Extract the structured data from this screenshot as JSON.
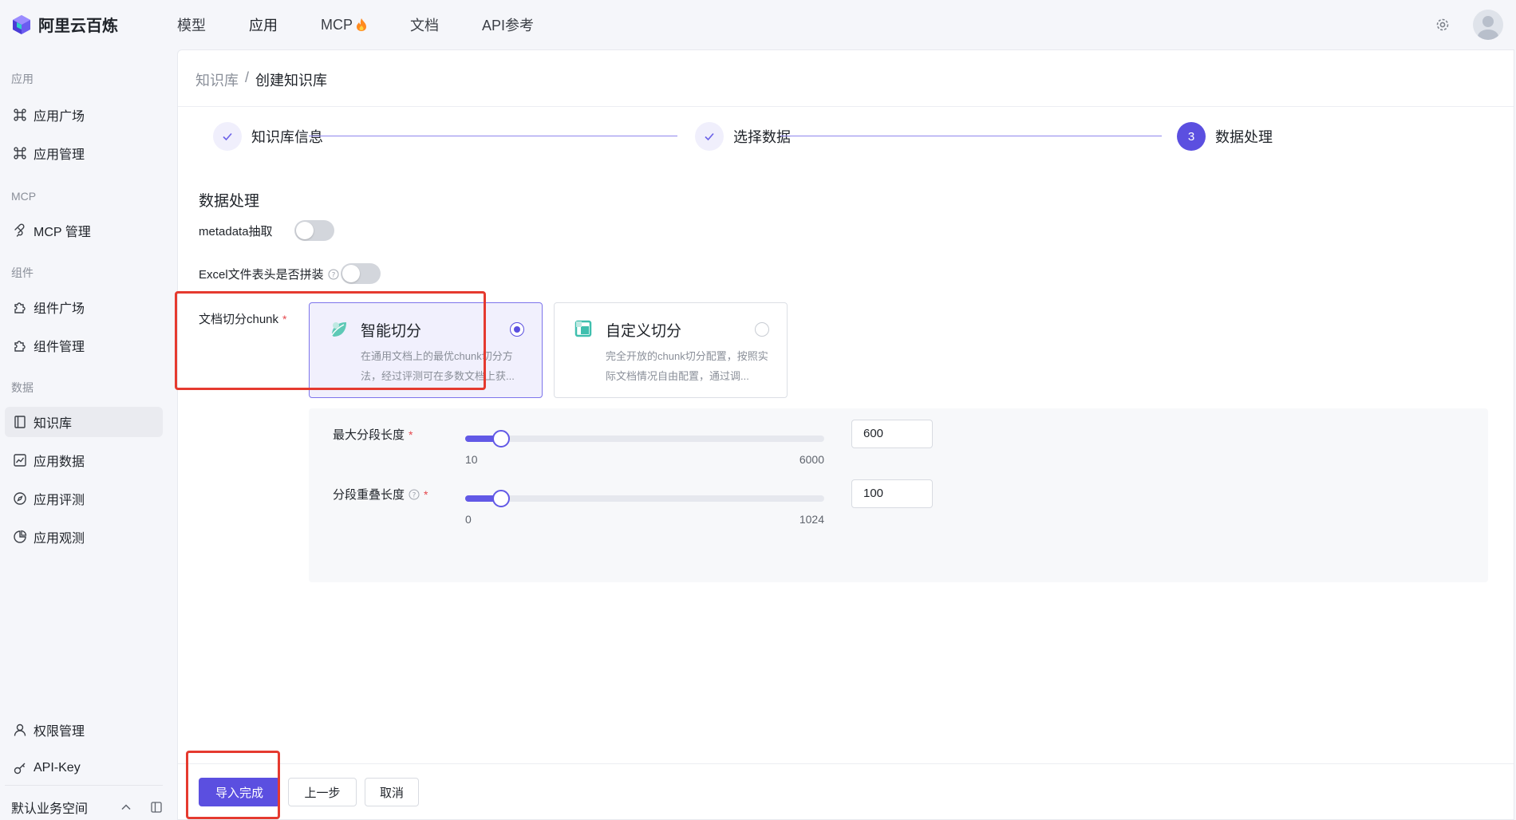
{
  "brand": {
    "name": "阿里云百炼"
  },
  "topnav": [
    {
      "label": "模型",
      "active": false
    },
    {
      "label": "应用",
      "active": true
    },
    {
      "label": "MCP",
      "active": false,
      "badge_icon": "fire-icon"
    },
    {
      "label": "文档",
      "active": false
    },
    {
      "label": "API参考",
      "active": false
    }
  ],
  "sidebar": {
    "groups": {
      "app": "应用",
      "mcp": "MCP",
      "component": "组件",
      "data": "数据"
    },
    "items": {
      "app_plaza": "应用广场",
      "app_manage": "应用管理",
      "mcp_manage": "MCP 管理",
      "comp_plaza": "组件广场",
      "comp_manage": "组件管理",
      "knowledge": "知识库",
      "app_data": "应用数据",
      "app_eval": "应用评测",
      "app_observe": "应用观测",
      "permissions": "权限管理",
      "api_key": "API-Key"
    },
    "workspace": "默认业务空间"
  },
  "breadcrumb": {
    "parent": "知识库",
    "separator": "/",
    "current": "创建知识库"
  },
  "steps": [
    {
      "label": "知识库信息",
      "status": "done"
    },
    {
      "label": "选择数据",
      "status": "done"
    },
    {
      "label": "数据处理",
      "status": "current",
      "number": "3"
    }
  ],
  "form": {
    "section_title": "数据处理",
    "metadata_label": "metadata抽取",
    "metadata_on": false,
    "excel_label": "Excel文件表头是否拼装",
    "excel_on": false,
    "chunk_label": "文档切分chunk",
    "chunk_options": [
      {
        "title": "智能切分",
        "desc": "在通用文档上的最优chunk切分方法，经过评测可在多数文档上获...",
        "selected": true
      },
      {
        "title": "自定义切分",
        "desc": "完全开放的chunk切分配置，按照实际文档情况自由配置，通过调...",
        "selected": false
      }
    ],
    "max_segment": {
      "label": "最大分段长度",
      "min": 10,
      "max": 6000,
      "value": 600,
      "min_text": "10",
      "max_text": "6000",
      "value_text": "600"
    },
    "overlap": {
      "label": "分段重叠长度",
      "min": 0,
      "max": 1024,
      "value": 100,
      "min_text": "0",
      "max_text": "1024",
      "value_text": "100"
    }
  },
  "footer": {
    "finish": "导入完成",
    "prev": "上一步",
    "cancel": "取消"
  }
}
